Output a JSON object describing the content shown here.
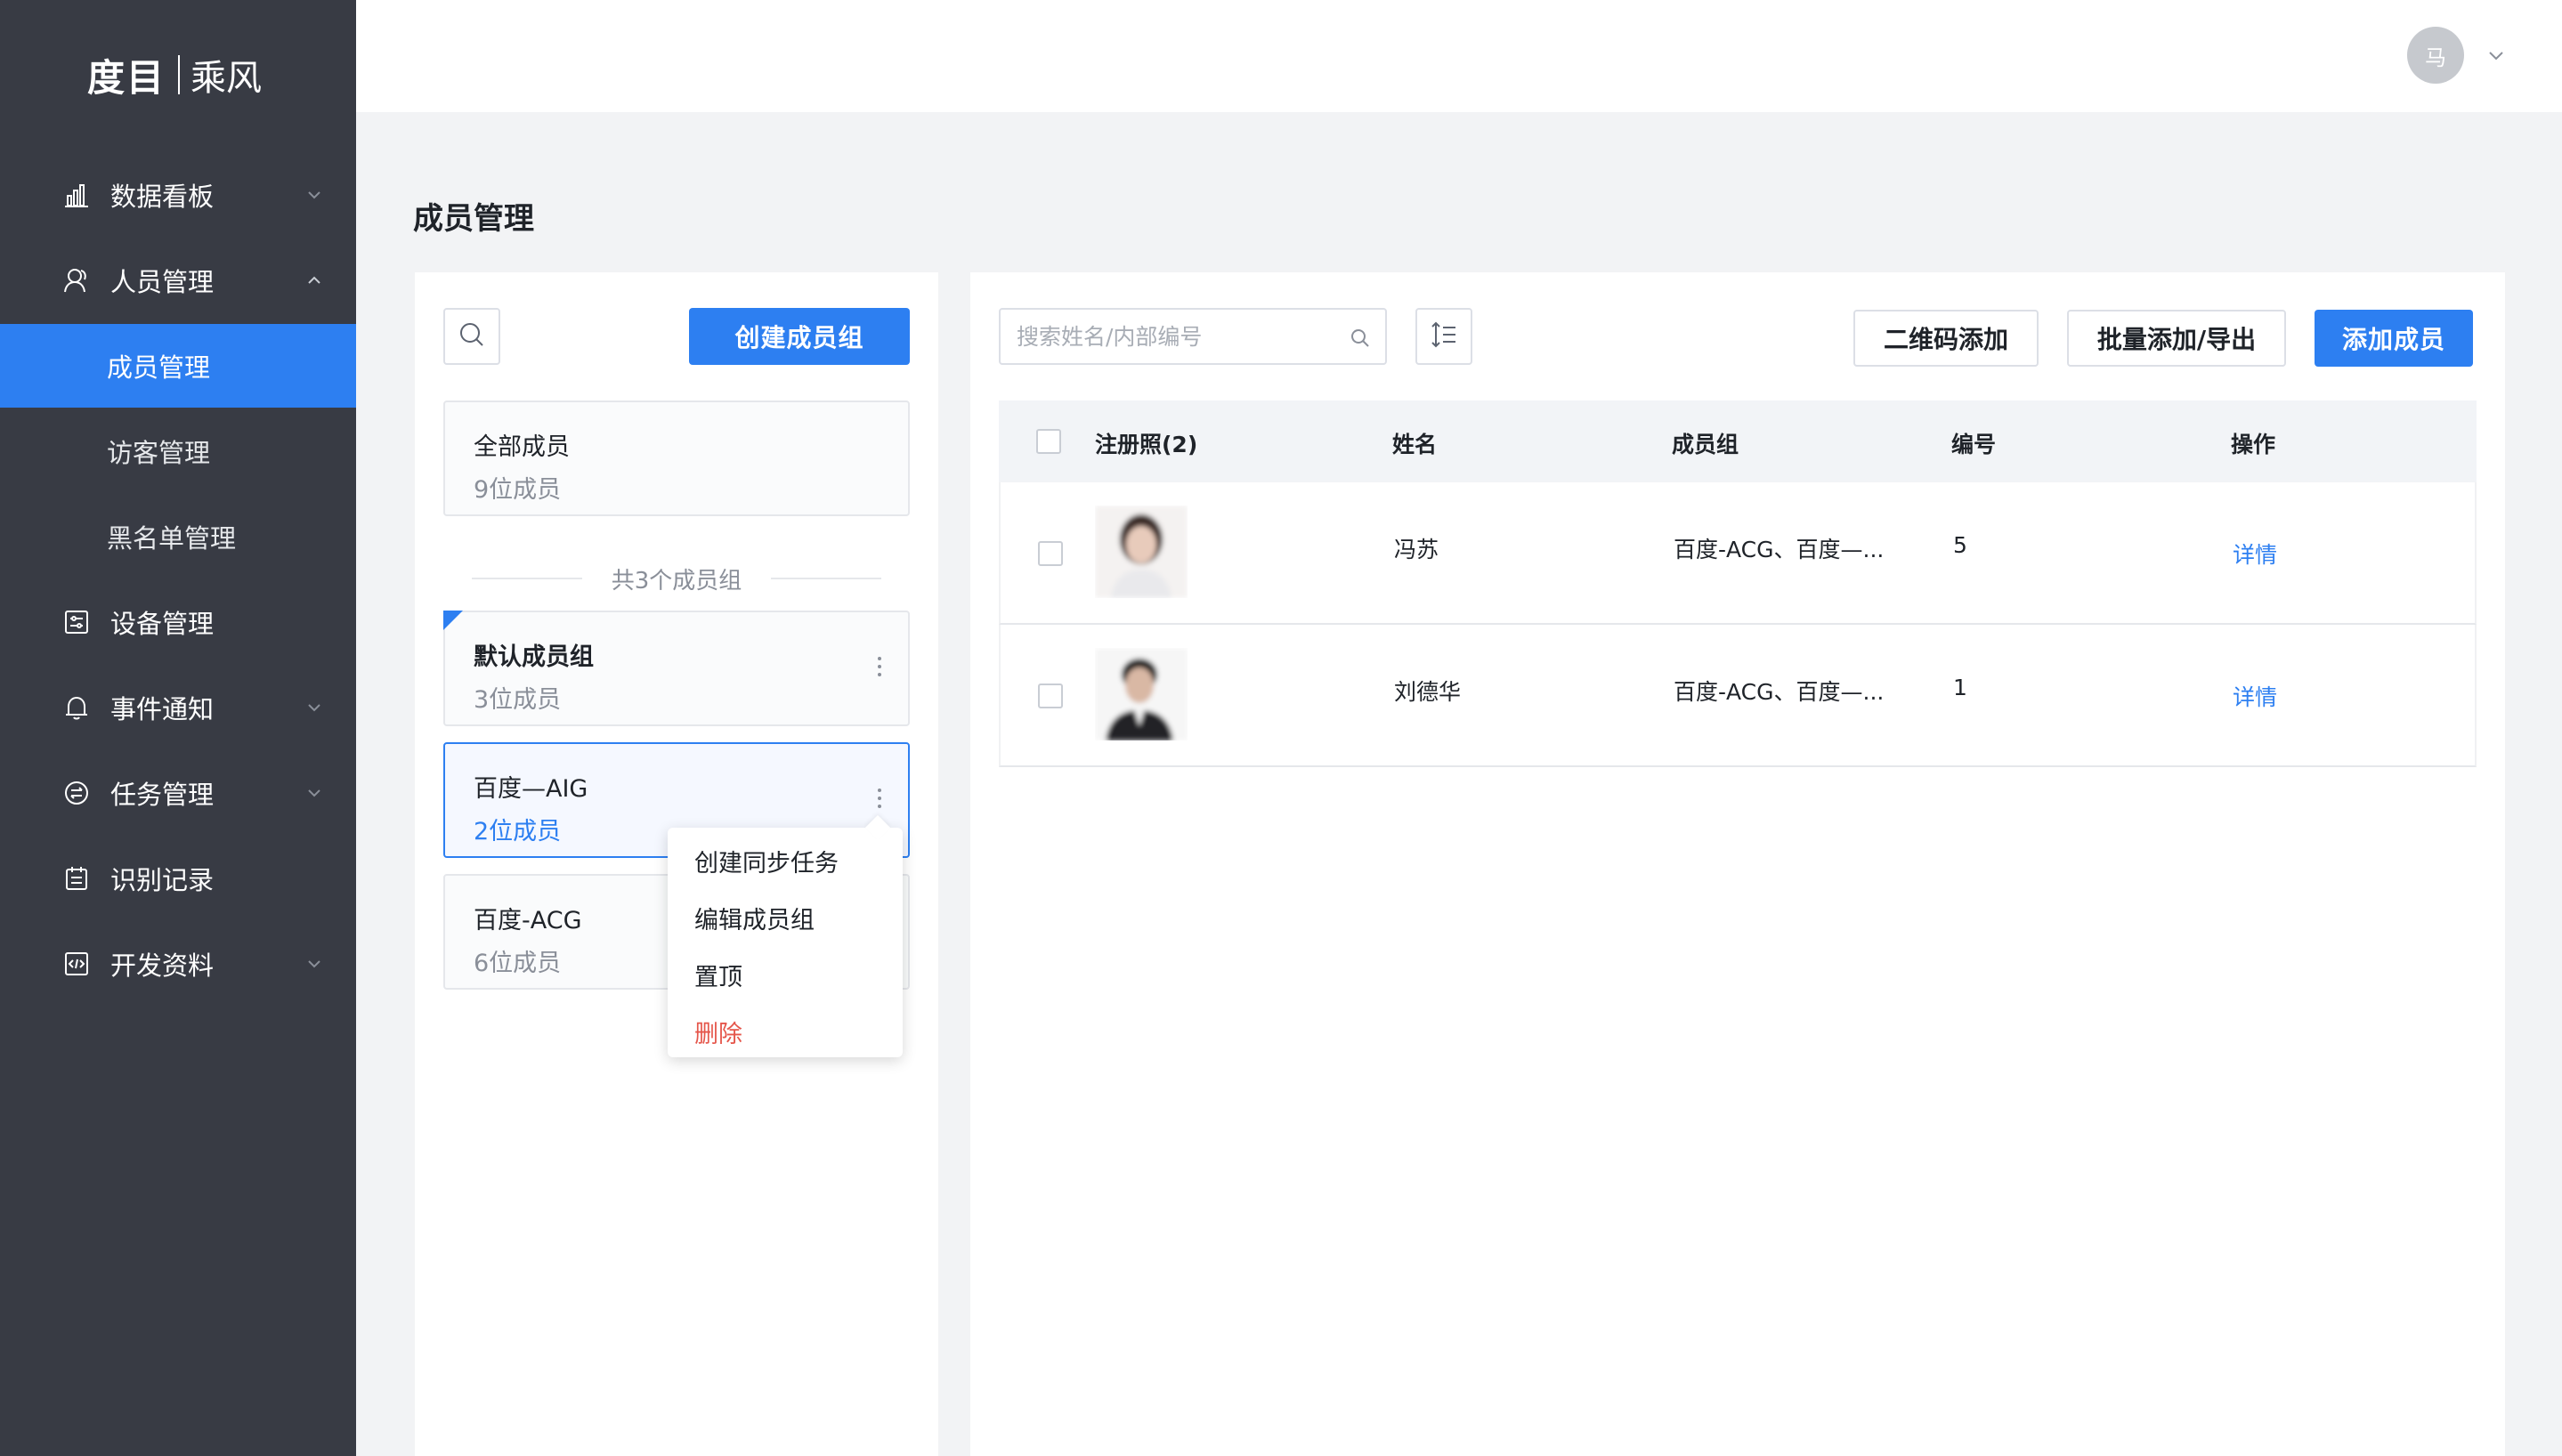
{
  "app": {
    "logo_main": "度目",
    "logo_sub": "乘风"
  },
  "sidebar": {
    "items": [
      {
        "label": "数据看板",
        "icon": "bar-chart-icon",
        "expandable": true,
        "expanded": false
      },
      {
        "label": "人员管理",
        "icon": "people-icon",
        "expandable": true,
        "expanded": true
      },
      {
        "label": "设备管理",
        "icon": "device-icon",
        "expandable": false
      },
      {
        "label": "事件通知",
        "icon": "bell-icon",
        "expandable": true,
        "expanded": false
      },
      {
        "label": "任务管理",
        "icon": "task-icon",
        "expandable": true,
        "expanded": false
      },
      {
        "label": "识别记录",
        "icon": "record-icon",
        "expandable": false
      },
      {
        "label": "开发资料",
        "icon": "code-icon",
        "expandable": true,
        "expanded": false
      }
    ],
    "sub_items": [
      {
        "label": "成员管理",
        "active": true
      },
      {
        "label": "访客管理",
        "active": false
      },
      {
        "label": "黑名单管理",
        "active": false
      }
    ]
  },
  "header": {
    "avatar_text": "马"
  },
  "page": {
    "title": "成员管理"
  },
  "groups_panel": {
    "create_button": "创建成员组",
    "all_members": {
      "name": "全部成员",
      "count": "9位成员"
    },
    "divider_text": "共3个成员组",
    "groups": [
      {
        "name": "默认成员组",
        "count": "3位成员",
        "pinned": true
      },
      {
        "name": "百度—AIG",
        "count": "2位成员",
        "selected": true
      },
      {
        "name": "百度-ACG",
        "count": "6位成员"
      }
    ],
    "menu": {
      "items": [
        "创建同步任务",
        "编辑成员组",
        "置顶",
        "删除"
      ]
    }
  },
  "members_panel": {
    "search_placeholder": "搜索姓名/内部编号",
    "buttons": {
      "qr_add": "二维码添加",
      "batch": "批量添加/导出",
      "add_member": "添加成员"
    },
    "columns": [
      "注册照(2)",
      "姓名",
      "成员组",
      "编号",
      "操作"
    ],
    "rows": [
      {
        "name": "冯苏",
        "group": "百度-ACG、百度—...",
        "id": "5",
        "action": "详情"
      },
      {
        "name": "刘德华",
        "group": "百度-ACG、百度—...",
        "id": "1",
        "action": "详情"
      }
    ]
  },
  "colors": {
    "primary": "#2d7ff1",
    "sidebar_bg": "#383b44",
    "danger": "#e5564b"
  }
}
